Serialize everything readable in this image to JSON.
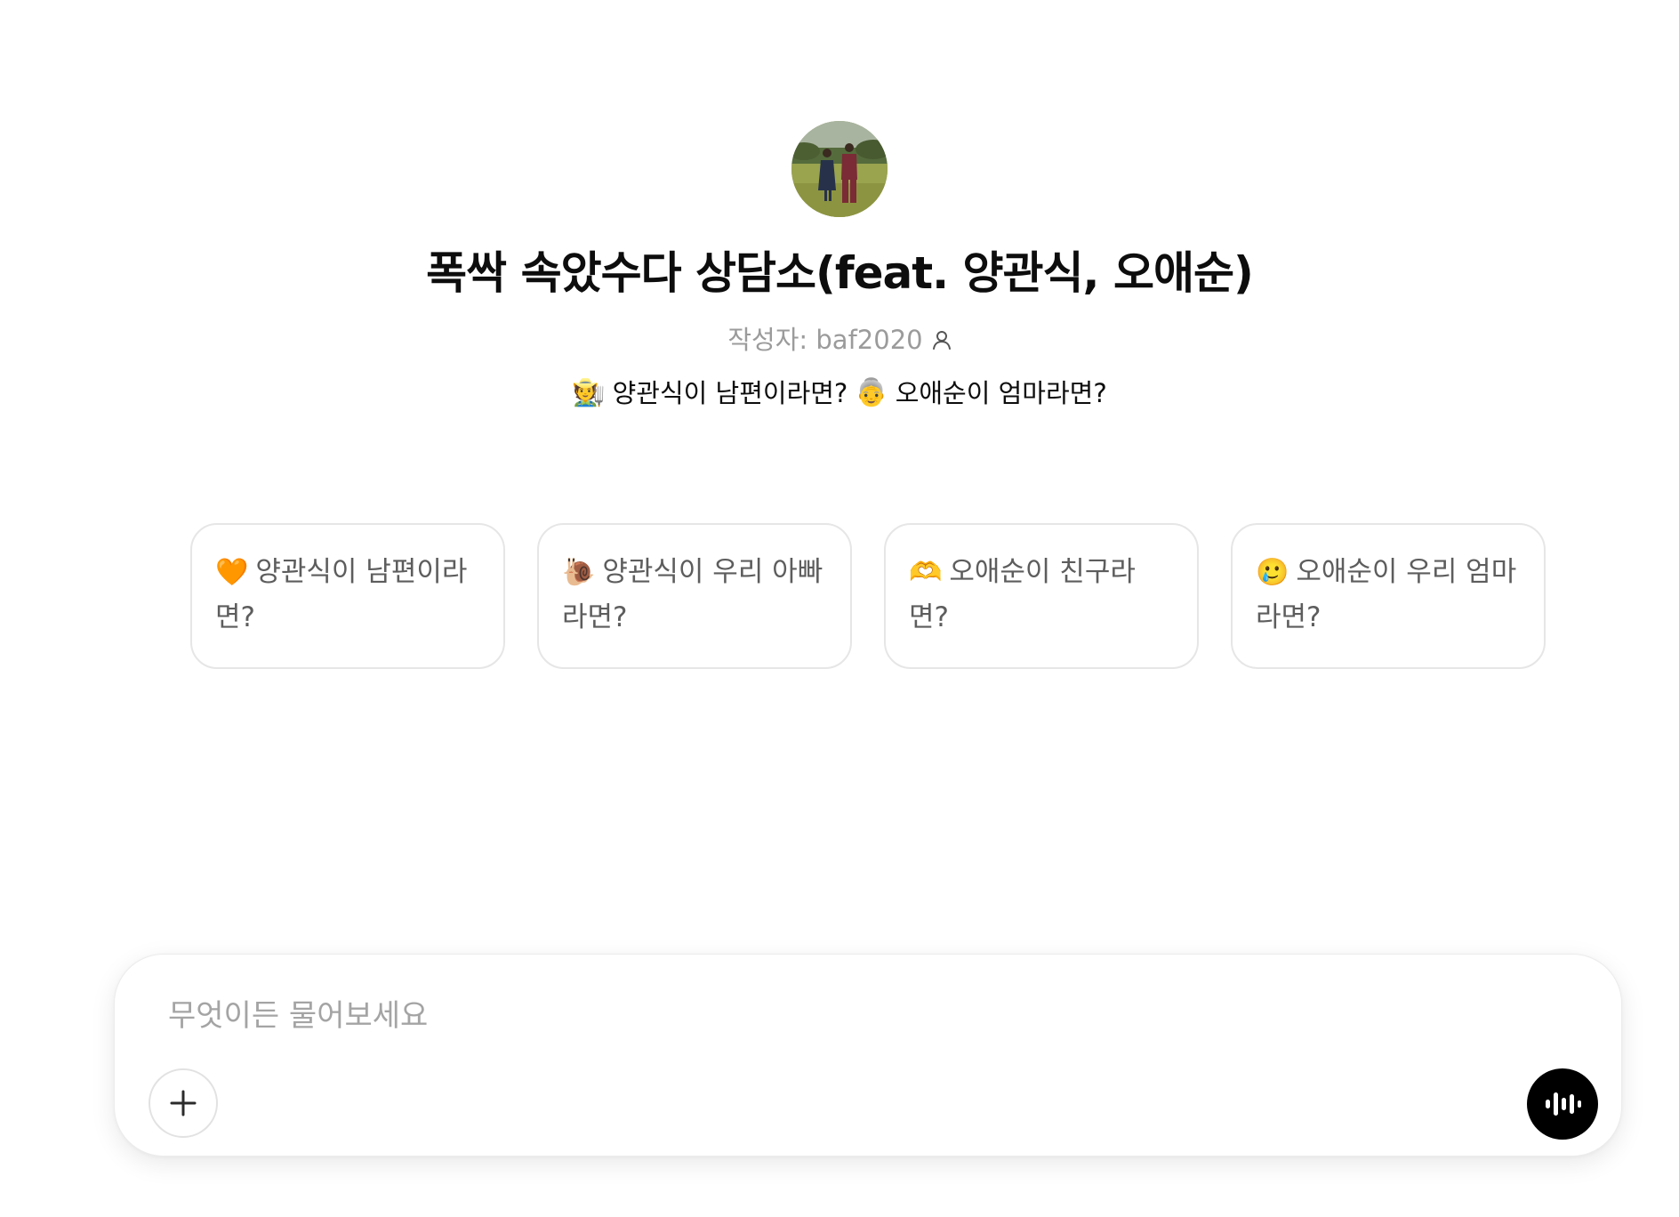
{
  "gpt": {
    "title": "폭싹 속았수다 상담소(feat. 양관식, 오애순)",
    "author": "작성자: baf2020",
    "description_emoji_1": "🧑‍🌾",
    "description_text_1": "양관식이 남편이라면?",
    "description_emoji_2": "👵",
    "description_text_2": "오애순이 엄마라면?"
  },
  "starters": [
    {
      "emoji": "🧡",
      "label": "양관식이 남편이라면?"
    },
    {
      "emoji": "🐌",
      "label": "양관식이 우리 아빠라면?"
    },
    {
      "emoji": "🫶",
      "label": "오애순이 친구라면?"
    },
    {
      "emoji": "🥲",
      "label": "오애순이 우리 엄마라면?"
    }
  ],
  "composer": {
    "placeholder": "무엇이든 물어보세요"
  },
  "icons": {
    "avatar": "avatar-photo",
    "author": "person-icon",
    "add": "plus-icon",
    "voice": "voice-waveform-icon"
  },
  "colors": {
    "voice_button": "#000000",
    "muted_text": "#9b9b9b",
    "card_border": "#e6e6e6"
  }
}
